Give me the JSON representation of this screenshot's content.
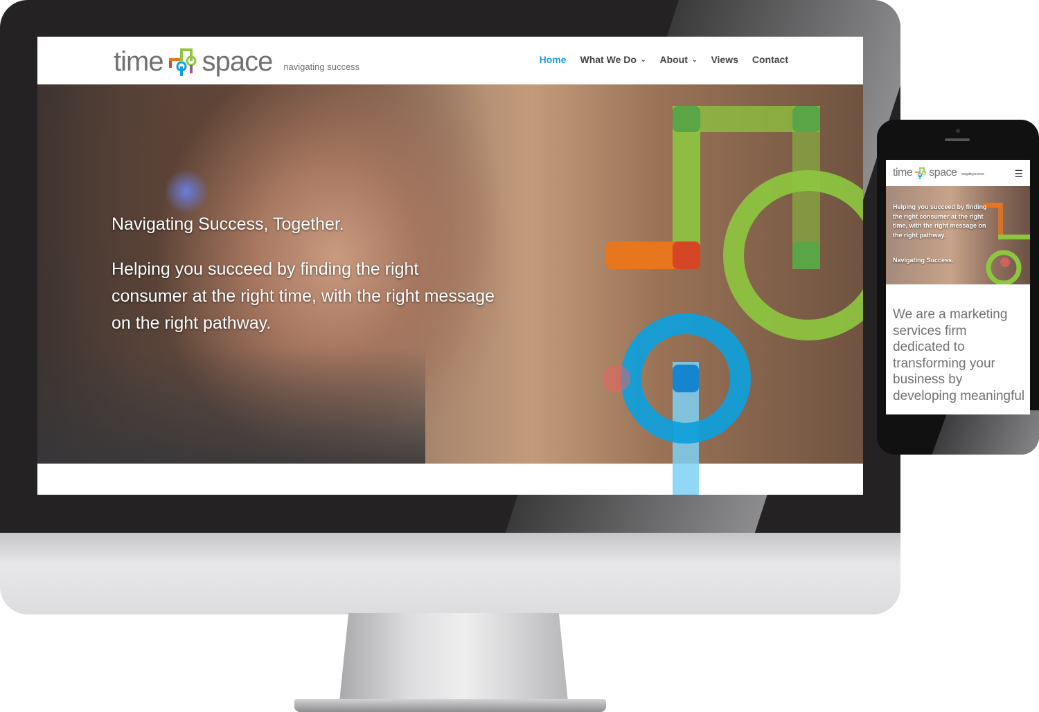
{
  "desktop": {
    "logo": {
      "word_left": "time",
      "word_right": "space",
      "tagline": "navigating success"
    },
    "nav": [
      {
        "label": "Home",
        "active": true,
        "has_dropdown": false
      },
      {
        "label": "What We Do",
        "active": false,
        "has_dropdown": true
      },
      {
        "label": "About",
        "active": false,
        "has_dropdown": true
      },
      {
        "label": "Views",
        "active": false,
        "has_dropdown": false
      },
      {
        "label": "Contact",
        "active": false,
        "has_dropdown": false
      }
    ],
    "hero": {
      "title": "Navigating Success, Together.",
      "text": "Helping you succeed by finding the right consumer at the right time, with the right message on the right pathway."
    }
  },
  "mobile": {
    "logo": {
      "word_left": "time",
      "word_right": "space",
      "tagline": "navigating success"
    },
    "menu_icon": "hamburger-icon",
    "hero": {
      "text": "Helping you succeed by finding the right consumer at the right time, with the right message on the right pathway.",
      "title": "Navigating Success."
    },
    "body": "We are a marketing services firm dedicated to transforming your business by developing meaningful"
  },
  "colors": {
    "accent": "#1e9bd7",
    "green": "#8dc63f",
    "dark_green": "#5aa545",
    "orange": "#e8761f",
    "red": "#d64526",
    "blue": "#0ea0dc",
    "text_gray": "#707173"
  }
}
